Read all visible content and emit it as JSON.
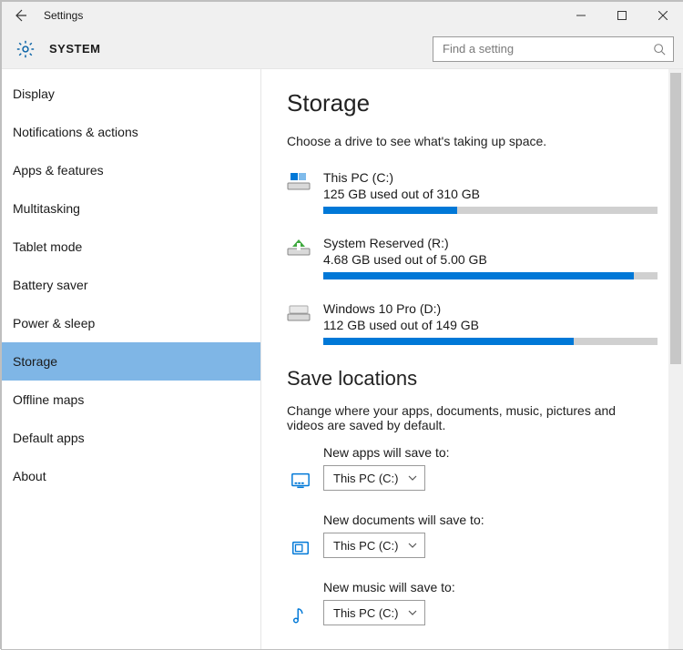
{
  "window": {
    "title": "Settings"
  },
  "header": {
    "title": "SYSTEM",
    "search_placeholder": "Find a setting"
  },
  "sidebar": {
    "items": [
      {
        "label": "Display",
        "selected": false
      },
      {
        "label": "Notifications & actions",
        "selected": false
      },
      {
        "label": "Apps & features",
        "selected": false
      },
      {
        "label": "Multitasking",
        "selected": false
      },
      {
        "label": "Tablet mode",
        "selected": false
      },
      {
        "label": "Battery saver",
        "selected": false
      },
      {
        "label": "Power & sleep",
        "selected": false
      },
      {
        "label": "Storage",
        "selected": true
      },
      {
        "label": "Offline maps",
        "selected": false
      },
      {
        "label": "Default apps",
        "selected": false
      },
      {
        "label": "About",
        "selected": false
      }
    ]
  },
  "main": {
    "storage_heading": "Storage",
    "storage_desc": "Choose a drive to see what's taking up space.",
    "drives": [
      {
        "name": "This PC (C:)",
        "used_text": "125 GB used out of 310 GB",
        "fill_pct": 40,
        "icon": "drive-windows"
      },
      {
        "name": "System Reserved (R:)",
        "used_text": "4.68 GB used out of 5.00 GB",
        "fill_pct": 93,
        "icon": "drive-reserved"
      },
      {
        "name": "Windows 10 Pro (D:)",
        "used_text": "112 GB used out of 149 GB",
        "fill_pct": 75,
        "icon": "drive-generic"
      }
    ],
    "save_heading": "Save locations",
    "save_desc": "Change where your apps, documents, music, pictures and videos are saved by default.",
    "save_locations": [
      {
        "label": "New apps will save to:",
        "value": "This PC (C:)",
        "icon": "apps"
      },
      {
        "label": "New documents will save to:",
        "value": "This PC (C:)",
        "icon": "documents"
      },
      {
        "label": "New music will save to:",
        "value": "This PC (C:)",
        "icon": "music"
      }
    ]
  }
}
